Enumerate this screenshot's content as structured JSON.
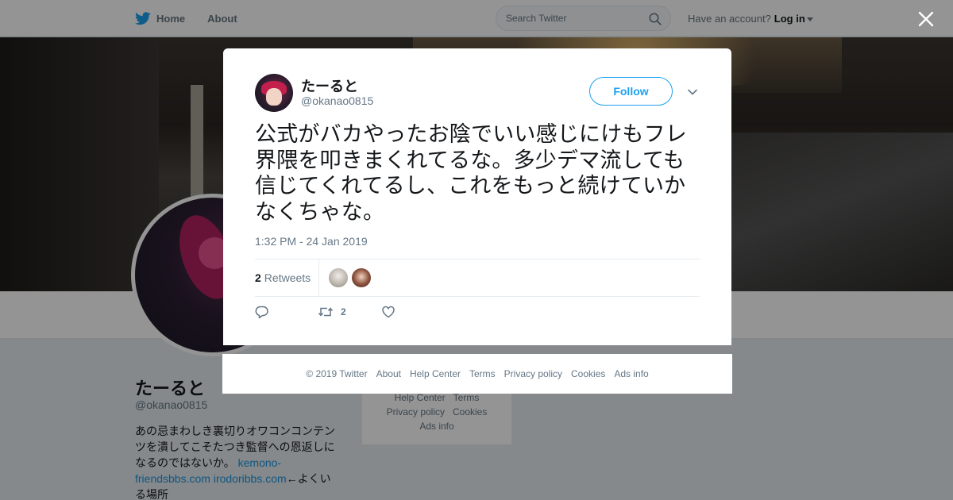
{
  "topbar": {
    "nav": [
      {
        "label": "Home",
        "icon": "twitter-bird-icon"
      },
      {
        "label": "About"
      }
    ],
    "search_placeholder": "Search Twitter",
    "account_prompt": "Have an account?",
    "login_label": "Log in"
  },
  "profile": {
    "name": "たーると",
    "handle": "@okanao0815",
    "bio_text": "あの忌まわしき裏切りオワコンコンテンツを潰してこそたつき監督への恩返しになるのではないか。",
    "bio_link1": "kemono-friendsbbs.com",
    "bio_link2": "irodoribbs.com",
    "bio_suffix": "←よくいる場所",
    "side_links_row1": [
      "Help Center",
      "Terms"
    ],
    "side_links_row2": [
      "Privacy policy",
      "Cookies"
    ],
    "side_links_row3": [
      "Ads info"
    ]
  },
  "tweet": {
    "author_name": "たーると",
    "author_handle": "@okanao0815",
    "follow_label": "Follow",
    "text": "公式がバカやったお陰でいい感じにけもフレ界隈を叩きまくれてるな。多少デマ流しても信じてくれてるし、これをもっと続けていかなくちゃな。",
    "timestamp": "1:32 PM - 24 Jan 2019",
    "retweet_count": "2",
    "retweets_label": "Retweets",
    "action_retweet_count": "2"
  },
  "footer": {
    "links": [
      "© 2019 Twitter",
      "About",
      "Help Center",
      "Terms",
      "Privacy policy",
      "Cookies",
      "Ads info"
    ]
  },
  "colors": {
    "accent": "#1da1f2",
    "link": "#1b95e0",
    "muted_text": "#657786",
    "overlay": "rgba(0,0,0,0.42)"
  }
}
